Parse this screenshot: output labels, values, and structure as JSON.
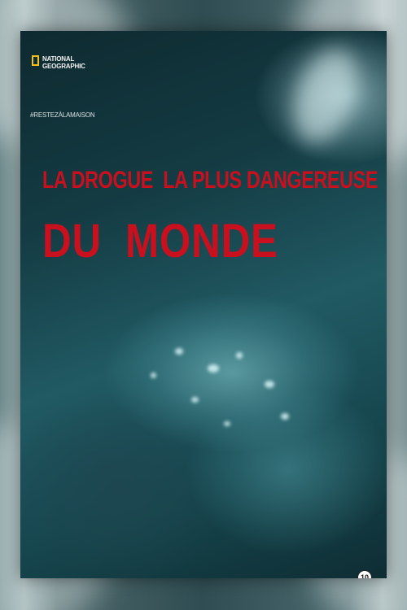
{
  "poster": {
    "logo": {
      "line1": "NATIONAL",
      "line2": "GEOGRAPHIC",
      "icon": "yellow-rectangle-icon",
      "color": "#f3c11e"
    },
    "hashtag": "#RESTEZÀLAMAISON",
    "title_line1": "LA DROGUE  LA PLUS DANGEREUSE",
    "title_line2": "DU  MONDE",
    "title_color": "#c8101e",
    "age_rating": "10"
  }
}
